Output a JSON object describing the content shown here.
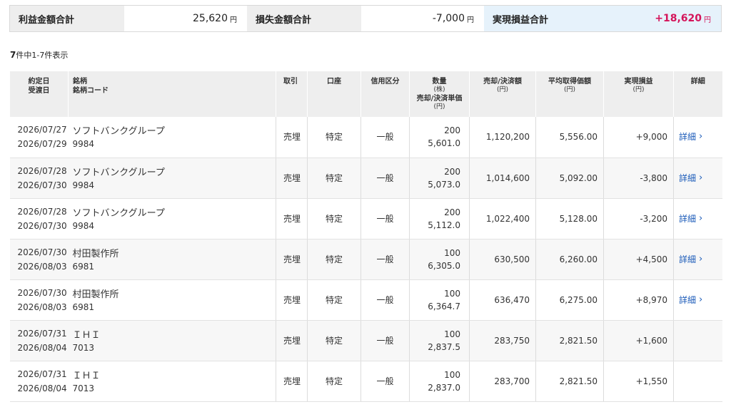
{
  "summary": {
    "profit_label": "利益金額合計",
    "profit_value": "25,620",
    "loss_label": "損失金額合計",
    "loss_value": "-7,000",
    "realized_label": "実現損益合計",
    "realized_value": "+18,620",
    "unit": "円"
  },
  "count_text_bold": "7",
  "count_text": "件中1-7件表示",
  "headers": {
    "date1": "約定日",
    "date2": "受渡日",
    "name1": "銘柄",
    "name2": "銘柄コード",
    "type": "取引",
    "account": "口座",
    "margin": "信用区分",
    "qty1": "数量",
    "qty_unit": "(株)",
    "qty2": "売却/決済単価",
    "qty2_unit": "(円)",
    "amount": "売却/決済額",
    "amount_unit": "(円)",
    "avg": "平均取得価額",
    "avg_unit": "(円)",
    "pl": "実現損益",
    "pl_unit": "(円)",
    "detail": "詳細"
  },
  "detail_label": "詳細",
  "detail_chevron": "chevron-right-icon",
  "colors": {
    "positive": "#d4145a",
    "negative": "#2f8f2f",
    "link": "#1a5ab8"
  },
  "rows": [
    {
      "trade_date": "2026/07/27",
      "settle_date": "2026/07/29",
      "name": "ソフトバンクグループ",
      "code": "9984",
      "type": "売埋",
      "account": "特定",
      "margin": "一般",
      "qty": "200",
      "price": "5,601.0",
      "amount": "1,120,200",
      "avg": "5,556.00",
      "pl": "+9,000",
      "sign": "pos",
      "has_detail": true
    },
    {
      "trade_date": "2026/07/28",
      "settle_date": "2026/07/30",
      "name": "ソフトバンクグループ",
      "code": "9984",
      "type": "売埋",
      "account": "特定",
      "margin": "一般",
      "qty": "200",
      "price": "5,073.0",
      "amount": "1,014,600",
      "avg": "5,092.00",
      "pl": "-3,800",
      "sign": "neg",
      "has_detail": true
    },
    {
      "trade_date": "2026/07/28",
      "settle_date": "2026/07/30",
      "name": "ソフトバンクグループ",
      "code": "9984",
      "type": "売埋",
      "account": "特定",
      "margin": "一般",
      "qty": "200",
      "price": "5,112.0",
      "amount": "1,022,400",
      "avg": "5,128.00",
      "pl": "-3,200",
      "sign": "neg",
      "has_detail": true
    },
    {
      "trade_date": "2026/07/30",
      "settle_date": "2026/08/03",
      "name": "村田製作所",
      "code": "6981",
      "type": "売埋",
      "account": "特定",
      "margin": "一般",
      "qty": "100",
      "price": "6,305.0",
      "amount": "630,500",
      "avg": "6,260.00",
      "pl": "+4,500",
      "sign": "pos",
      "has_detail": true
    },
    {
      "trade_date": "2026/07/30",
      "settle_date": "2026/08/03",
      "name": "村田製作所",
      "code": "6981",
      "type": "売埋",
      "account": "特定",
      "margin": "一般",
      "qty": "100",
      "price": "6,364.7",
      "amount": "636,470",
      "avg": "6,275.00",
      "pl": "+8,970",
      "sign": "pos",
      "has_detail": true
    },
    {
      "trade_date": "2026/07/31",
      "settle_date": "2026/08/04",
      "name": "ＩＨＩ",
      "code": "7013",
      "type": "売埋",
      "account": "特定",
      "margin": "一般",
      "qty": "100",
      "price": "2,837.5",
      "amount": "283,750",
      "avg": "2,821.50",
      "pl": "+1,600",
      "sign": "pos",
      "has_detail": false
    },
    {
      "trade_date": "2026/07/31",
      "settle_date": "2026/08/04",
      "name": "ＩＨＩ",
      "code": "7013",
      "type": "売埋",
      "account": "特定",
      "margin": "一般",
      "qty": "100",
      "price": "2,837.0",
      "amount": "283,700",
      "avg": "2,821.50",
      "pl": "+1,550",
      "sign": "pos",
      "has_detail": false
    }
  ]
}
